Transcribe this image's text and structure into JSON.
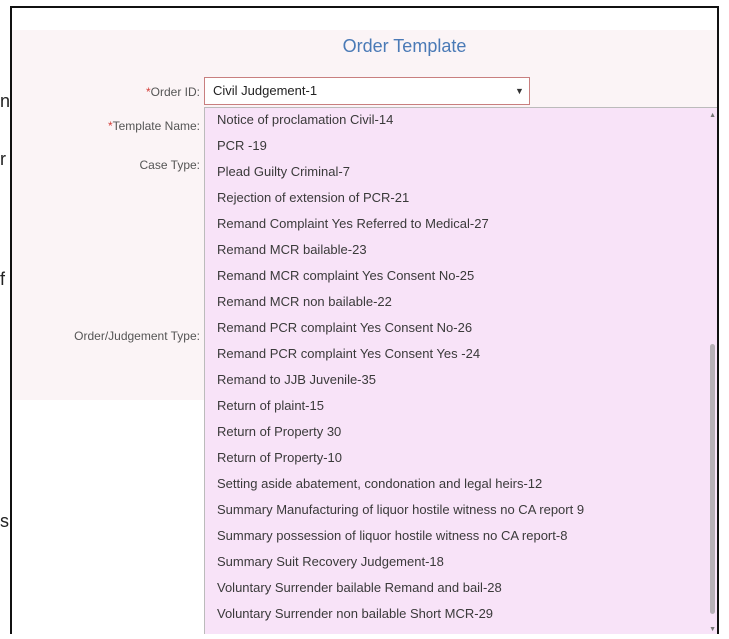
{
  "edge_chars": [
    "n",
    "r",
    "f",
    "s"
  ],
  "form": {
    "title": "Order Template",
    "order_id_label": "Order ID:",
    "template_name_label": "Template Name:",
    "case_type_label": "Case Type:",
    "judgement_type_label": "Order/Judgement Type:",
    "required_mark": "*",
    "order_id_value": "Civil Judgement-1",
    "caret_icon": "▼"
  },
  "dropdown": {
    "options": [
      "Notice of proclamation Civil-14",
      "PCR -19",
      "Plead Guilty Criminal-7",
      "Rejection of extension of PCR-21",
      "Remand Complaint Yes Referred to Medical-27",
      "Remand MCR bailable-23",
      "Remand MCR complaint Yes Consent No-25",
      "Remand MCR non bailable-22",
      "Remand PCR complaint Yes Consent No-26",
      "Remand PCR complaint Yes Consent Yes -24",
      "Remand to JJB Juvenile-35",
      "Return of plaint-15",
      "Return of Property 30",
      "Return of Property-10",
      "Setting aside abatement, condonation and legal heirs-12",
      "Summary Manufacturing of liquor hostile witness no CA report 9",
      "Summary possession of liquor hostile witness no CA report-8",
      "Summary Suit Recovery Judgement-18",
      "Voluntary Surrender bailable Remand and bail-28",
      "Voluntary Surrender non bailable Short MCR-29"
    ]
  },
  "colors": {
    "title": "#4a7ab6",
    "dropdown_bg": "#f8e3f8",
    "required": "#d43f3a"
  }
}
